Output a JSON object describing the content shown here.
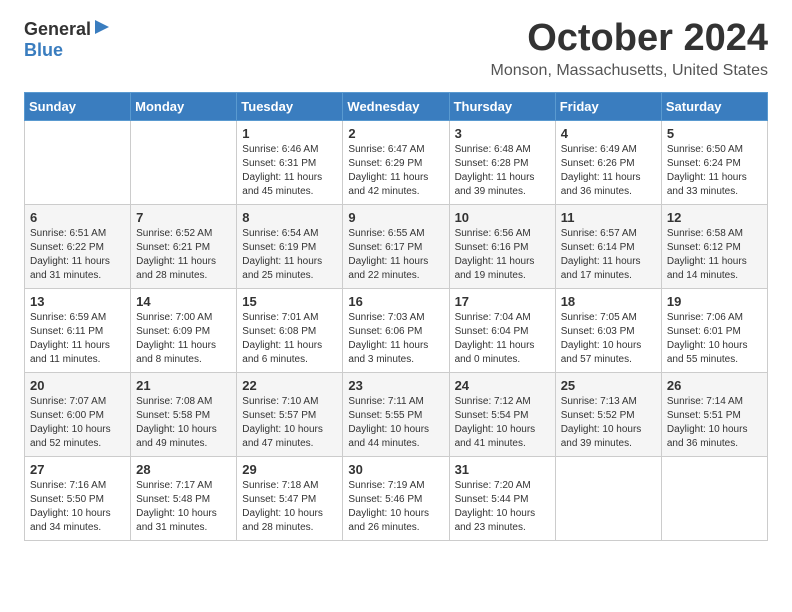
{
  "logo": {
    "general": "General",
    "blue": "Blue"
  },
  "title": "October 2024",
  "location": "Monson, Massachusetts, United States",
  "days_of_week": [
    "Sunday",
    "Monday",
    "Tuesday",
    "Wednesday",
    "Thursday",
    "Friday",
    "Saturday"
  ],
  "weeks": [
    [
      {
        "day": "",
        "info": ""
      },
      {
        "day": "",
        "info": ""
      },
      {
        "day": "1",
        "info": "Sunrise: 6:46 AM\nSunset: 6:31 PM\nDaylight: 11 hours and 45 minutes."
      },
      {
        "day": "2",
        "info": "Sunrise: 6:47 AM\nSunset: 6:29 PM\nDaylight: 11 hours and 42 minutes."
      },
      {
        "day": "3",
        "info": "Sunrise: 6:48 AM\nSunset: 6:28 PM\nDaylight: 11 hours and 39 minutes."
      },
      {
        "day": "4",
        "info": "Sunrise: 6:49 AM\nSunset: 6:26 PM\nDaylight: 11 hours and 36 minutes."
      },
      {
        "day": "5",
        "info": "Sunrise: 6:50 AM\nSunset: 6:24 PM\nDaylight: 11 hours and 33 minutes."
      }
    ],
    [
      {
        "day": "6",
        "info": "Sunrise: 6:51 AM\nSunset: 6:22 PM\nDaylight: 11 hours and 31 minutes."
      },
      {
        "day": "7",
        "info": "Sunrise: 6:52 AM\nSunset: 6:21 PM\nDaylight: 11 hours and 28 minutes."
      },
      {
        "day": "8",
        "info": "Sunrise: 6:54 AM\nSunset: 6:19 PM\nDaylight: 11 hours and 25 minutes."
      },
      {
        "day": "9",
        "info": "Sunrise: 6:55 AM\nSunset: 6:17 PM\nDaylight: 11 hours and 22 minutes."
      },
      {
        "day": "10",
        "info": "Sunrise: 6:56 AM\nSunset: 6:16 PM\nDaylight: 11 hours and 19 minutes."
      },
      {
        "day": "11",
        "info": "Sunrise: 6:57 AM\nSunset: 6:14 PM\nDaylight: 11 hours and 17 minutes."
      },
      {
        "day": "12",
        "info": "Sunrise: 6:58 AM\nSunset: 6:12 PM\nDaylight: 11 hours and 14 minutes."
      }
    ],
    [
      {
        "day": "13",
        "info": "Sunrise: 6:59 AM\nSunset: 6:11 PM\nDaylight: 11 hours and 11 minutes."
      },
      {
        "day": "14",
        "info": "Sunrise: 7:00 AM\nSunset: 6:09 PM\nDaylight: 11 hours and 8 minutes."
      },
      {
        "day": "15",
        "info": "Sunrise: 7:01 AM\nSunset: 6:08 PM\nDaylight: 11 hours and 6 minutes."
      },
      {
        "day": "16",
        "info": "Sunrise: 7:03 AM\nSunset: 6:06 PM\nDaylight: 11 hours and 3 minutes."
      },
      {
        "day": "17",
        "info": "Sunrise: 7:04 AM\nSunset: 6:04 PM\nDaylight: 11 hours and 0 minutes."
      },
      {
        "day": "18",
        "info": "Sunrise: 7:05 AM\nSunset: 6:03 PM\nDaylight: 10 hours and 57 minutes."
      },
      {
        "day": "19",
        "info": "Sunrise: 7:06 AM\nSunset: 6:01 PM\nDaylight: 10 hours and 55 minutes."
      }
    ],
    [
      {
        "day": "20",
        "info": "Sunrise: 7:07 AM\nSunset: 6:00 PM\nDaylight: 10 hours and 52 minutes."
      },
      {
        "day": "21",
        "info": "Sunrise: 7:08 AM\nSunset: 5:58 PM\nDaylight: 10 hours and 49 minutes."
      },
      {
        "day": "22",
        "info": "Sunrise: 7:10 AM\nSunset: 5:57 PM\nDaylight: 10 hours and 47 minutes."
      },
      {
        "day": "23",
        "info": "Sunrise: 7:11 AM\nSunset: 5:55 PM\nDaylight: 10 hours and 44 minutes."
      },
      {
        "day": "24",
        "info": "Sunrise: 7:12 AM\nSunset: 5:54 PM\nDaylight: 10 hours and 41 minutes."
      },
      {
        "day": "25",
        "info": "Sunrise: 7:13 AM\nSunset: 5:52 PM\nDaylight: 10 hours and 39 minutes."
      },
      {
        "day": "26",
        "info": "Sunrise: 7:14 AM\nSunset: 5:51 PM\nDaylight: 10 hours and 36 minutes."
      }
    ],
    [
      {
        "day": "27",
        "info": "Sunrise: 7:16 AM\nSunset: 5:50 PM\nDaylight: 10 hours and 34 minutes."
      },
      {
        "day": "28",
        "info": "Sunrise: 7:17 AM\nSunset: 5:48 PM\nDaylight: 10 hours and 31 minutes."
      },
      {
        "day": "29",
        "info": "Sunrise: 7:18 AM\nSunset: 5:47 PM\nDaylight: 10 hours and 28 minutes."
      },
      {
        "day": "30",
        "info": "Sunrise: 7:19 AM\nSunset: 5:46 PM\nDaylight: 10 hours and 26 minutes."
      },
      {
        "day": "31",
        "info": "Sunrise: 7:20 AM\nSunset: 5:44 PM\nDaylight: 10 hours and 23 minutes."
      },
      {
        "day": "",
        "info": ""
      },
      {
        "day": "",
        "info": ""
      }
    ]
  ]
}
